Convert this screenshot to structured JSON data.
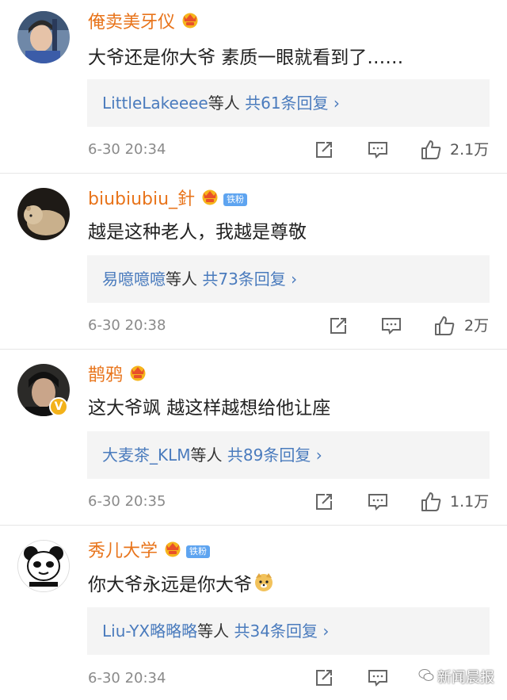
{
  "comments": [
    {
      "username": "俺卖美牙仪",
      "text": "大爷还是你大爷  素质一眼就看到了……",
      "replies_user": "LittleLakeeee",
      "replies_mid": "等人",
      "replies_count": "共61条回复",
      "replies_arrow": "›",
      "time": "6-30 20:34",
      "likes": "2.1万"
    },
    {
      "username": "biubiubiu_針",
      "fan_badge": "铁粉",
      "text": "越是这种老人，我越是尊敬",
      "replies_user": "易噫噫噫",
      "replies_mid": "等人",
      "replies_count": "共73条回复",
      "replies_arrow": "›",
      "time": "6-30 20:38",
      "likes": "2万"
    },
    {
      "username": "鹊鸦",
      "text": "这大爷飒 越这样越想给他让座",
      "replies_user": "大麦茶_KLM",
      "replies_mid": "等人",
      "replies_count": "共89条回复",
      "replies_arrow": "›",
      "time": "6-30 20:35",
      "likes": "1.1万"
    },
    {
      "username": "秀儿大学",
      "fan_badge": "铁粉",
      "text": "你大爷永远是你大爷",
      "replies_user": "Liu-YX略略略",
      "replies_mid": "等人",
      "replies_count": "共34条回复",
      "replies_arrow": "›",
      "time": "6-30 20:34",
      "likes": ""
    }
  ],
  "watermark": "新闻晨报",
  "colors": {
    "username": "#e8741b",
    "link": "#4a7bbd",
    "reply_bg": "#f4f4f4",
    "meta": "#8a8a8a"
  },
  "icons": [
    "share-icon",
    "comment-icon",
    "like-icon",
    "crown-vip-badge-icon",
    "verified-v-icon",
    "doge-emoji-icon"
  ]
}
